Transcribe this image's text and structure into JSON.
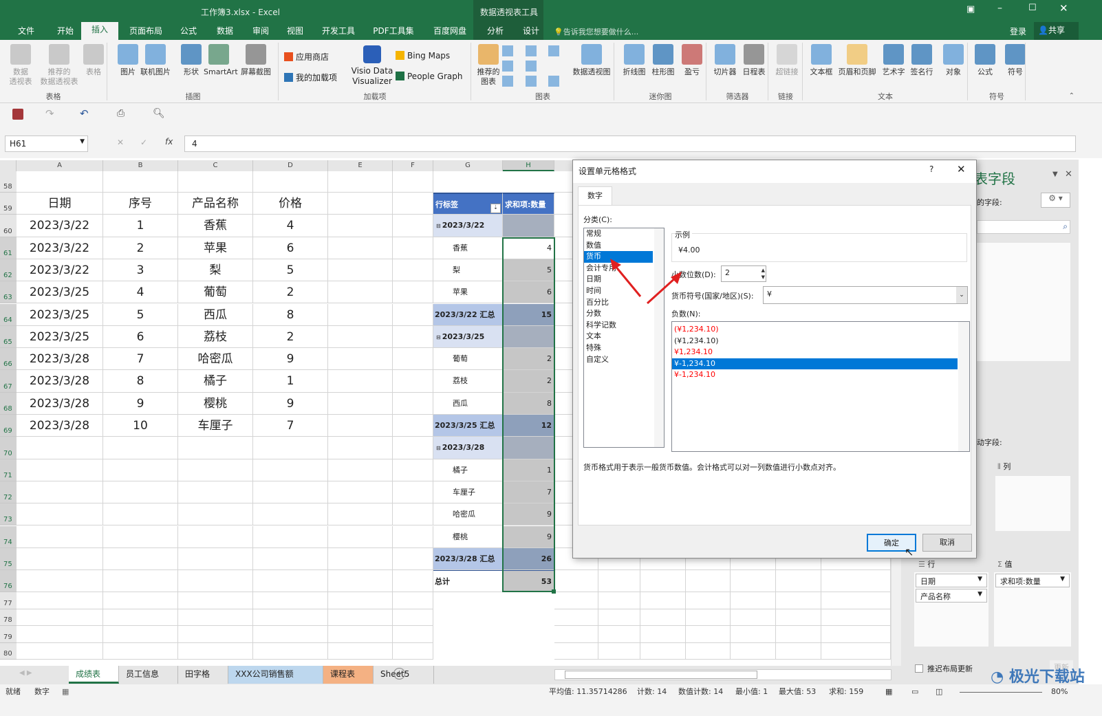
{
  "window": {
    "title": "工作簿3.xlsx - Excel",
    "context_tools": "数据透视表工具",
    "tell_me": "告诉我您想要做什么...",
    "login": "登录",
    "share": "共享"
  },
  "tabs": [
    "文件",
    "开始",
    "插入",
    "页面布局",
    "公式",
    "数据",
    "审阅",
    "视图",
    "开发工具",
    "PDF工具集",
    "百度网盘",
    "分析",
    "设计"
  ],
  "selected_tab": "插入",
  "ribbon": {
    "buttons": [
      {
        "label": "数据\n透视表",
        "icon": "pivot-table-icon",
        "disabled": true
      },
      {
        "label": "推荐的\n数据透视表",
        "icon": "recommended-pivot-icon",
        "disabled": true
      },
      {
        "label": "表格",
        "icon": "table-icon",
        "disabled": true
      },
      {
        "label": "图片",
        "icon": "picture-icon"
      },
      {
        "label": "联机图片",
        "icon": "online-picture-icon"
      },
      {
        "label": "形状",
        "icon": "shapes-icon"
      },
      {
        "label": "SmartArt",
        "icon": "smartart-icon"
      },
      {
        "label": "屏幕截图",
        "icon": "screenshot-icon"
      },
      {
        "label": "推荐的\n图表",
        "icon": "recommended-chart-icon"
      },
      {
        "label": "数据透视图",
        "icon": "pivot-chart-icon"
      },
      {
        "label": "折线图",
        "icon": "sparkline-line-icon"
      },
      {
        "label": "柱形图",
        "icon": "sparkline-column-icon"
      },
      {
        "label": "盈亏",
        "icon": "sparkline-winloss-icon"
      },
      {
        "label": "切片器",
        "icon": "slicer-icon"
      },
      {
        "label": "日程表",
        "icon": "timeline-icon"
      },
      {
        "label": "超链接",
        "icon": "hyperlink-icon",
        "disabled": true
      },
      {
        "label": "文本框",
        "icon": "textbox-icon"
      },
      {
        "label": "页眉和页脚",
        "icon": "header-footer-icon"
      },
      {
        "label": "艺术字",
        "icon": "wordart-icon"
      },
      {
        "label": "签名行",
        "icon": "signature-icon"
      },
      {
        "label": "对象",
        "icon": "object-icon"
      },
      {
        "label": "公式",
        "icon": "equation-icon"
      },
      {
        "label": "符号",
        "icon": "symbol-icon"
      }
    ],
    "addins": {
      "store": "应用商店",
      "my_addins": "我的加载项",
      "visio": "Visio Data\nVisualizer",
      "bing": "Bing Maps",
      "people": "People Graph"
    },
    "groups": [
      "表格",
      "插图",
      "加载项",
      "图表",
      "迷你图",
      "筛选器",
      "链接",
      "文本",
      "符号"
    ]
  },
  "formula_bar": {
    "name_box": "H61",
    "value": "4"
  },
  "columns": [
    "A",
    "B",
    "C",
    "D",
    "E",
    "F",
    "G",
    "H"
  ],
  "rows": [
    58,
    59,
    60,
    61,
    62,
    63,
    64,
    65,
    66,
    67,
    68,
    69,
    70,
    71,
    72,
    73,
    74,
    75,
    76,
    77,
    78,
    79,
    80
  ],
  "table": {
    "headers": [
      "日期",
      "序号",
      "产品名称",
      "价格"
    ],
    "rows": [
      [
        "2023/3/22",
        "1",
        "香蕉",
        "4"
      ],
      [
        "2023/3/22",
        "2",
        "苹果",
        "6"
      ],
      [
        "2023/3/22",
        "3",
        "梨",
        "5"
      ],
      [
        "2023/3/25",
        "4",
        "葡萄",
        "2"
      ],
      [
        "2023/3/25",
        "5",
        "西瓜",
        "8"
      ],
      [
        "2023/3/25",
        "6",
        "荔枝",
        "2"
      ],
      [
        "2023/3/28",
        "7",
        "哈密瓜",
        "9"
      ],
      [
        "2023/3/28",
        "8",
        "橘子",
        "1"
      ],
      [
        "2023/3/28",
        "9",
        "樱桃",
        "9"
      ],
      [
        "2023/3/28",
        "10",
        "车厘子",
        "7"
      ]
    ]
  },
  "pivot": {
    "header": [
      "行标签",
      "求和项:数量"
    ],
    "rows": [
      {
        "type": "group",
        "label": "2023/3/22",
        "value": ""
      },
      {
        "type": "item",
        "label": "香蕉",
        "value": "4"
      },
      {
        "type": "item",
        "label": "梨",
        "value": "5"
      },
      {
        "type": "item",
        "label": "苹果",
        "value": "6"
      },
      {
        "type": "subtotal",
        "label": "2023/3/22 汇总",
        "value": "15"
      },
      {
        "type": "group",
        "label": "2023/3/25",
        "value": ""
      },
      {
        "type": "item",
        "label": "葡萄",
        "value": "2"
      },
      {
        "type": "item",
        "label": "荔枝",
        "value": "2"
      },
      {
        "type": "item",
        "label": "西瓜",
        "value": "8"
      },
      {
        "type": "subtotal",
        "label": "2023/3/25 汇总",
        "value": "12"
      },
      {
        "type": "group",
        "label": "2023/3/28",
        "value": ""
      },
      {
        "type": "item",
        "label": "橘子",
        "value": "1"
      },
      {
        "type": "item",
        "label": "车厘子",
        "value": "7"
      },
      {
        "type": "item",
        "label": "哈密瓜",
        "value": "9"
      },
      {
        "type": "item",
        "label": "樱桃",
        "value": "9"
      },
      {
        "type": "subtotal",
        "label": "2023/3/28 汇总",
        "value": "26"
      },
      {
        "type": "total",
        "label": "总计",
        "value": "53"
      }
    ]
  },
  "dialog": {
    "title": "设置单元格格式",
    "help": "?",
    "tab": "数字",
    "category_label": "分类(C):",
    "categories": [
      "常规",
      "数值",
      "货币",
      "会计专用",
      "日期",
      "时间",
      "百分比",
      "分数",
      "科学记数",
      "文本",
      "特殊",
      "自定义"
    ],
    "selected_category": "货币",
    "sample_label": "示例",
    "sample_value": "¥4.00",
    "decimal_label": "小数位数(D):",
    "decimal_value": "2",
    "symbol_label": "货币符号(国家/地区)(S):",
    "symbol_value": "¥",
    "negative_label": "负数(N):",
    "negatives": [
      {
        "text": "(¥1,234.10)",
        "red": true
      },
      {
        "text": "(¥1,234.10)",
        "red": false
      },
      {
        "text": "¥1,234.10",
        "red": true
      },
      {
        "text": "¥-1,234.10",
        "red": false,
        "selected": true
      },
      {
        "text": "¥-1,234.10",
        "red": true
      }
    ],
    "description": "货币格式用于表示一般货币数值。会计格式可以对一列数值进行小数点对齐。",
    "ok": "确定",
    "cancel": "取消"
  },
  "field_pane": {
    "title": "表字段",
    "choose_label": "的字段:",
    "drag_label": "动字段:",
    "columns_area": "列",
    "rows_area": "行",
    "values_area": "值",
    "row_fields": [
      "日期",
      "产品名称"
    ],
    "value_fields": [
      "求和项:数量"
    ],
    "defer": "推迟布局更新",
    "update": "更新"
  },
  "sheet_tabs": [
    {
      "name": "成绩表",
      "active": true
    },
    {
      "name": "员工信息"
    },
    {
      "name": "田字格"
    },
    {
      "name": "XXX公司销售额",
      "color": "#bdd7ee"
    },
    {
      "name": "课程表",
      "color": "#f4b183"
    },
    {
      "name": "Sheet5"
    }
  ],
  "status": {
    "ready": "就绪",
    "mode": "数字",
    "average": "平均值: 11.35714286",
    "count": "计数: 14",
    "numcount": "数值计数: 14",
    "min": "最小值: 1",
    "max": "最大值: 53",
    "sum": "求和: 159",
    "zoom": "80%"
  },
  "watermark": "极光下载站",
  "colors": {
    "excel_green": "#217346",
    "pivot_header": "#4472c4",
    "selection": "#0078d7",
    "negative_red": "#ff0000"
  }
}
